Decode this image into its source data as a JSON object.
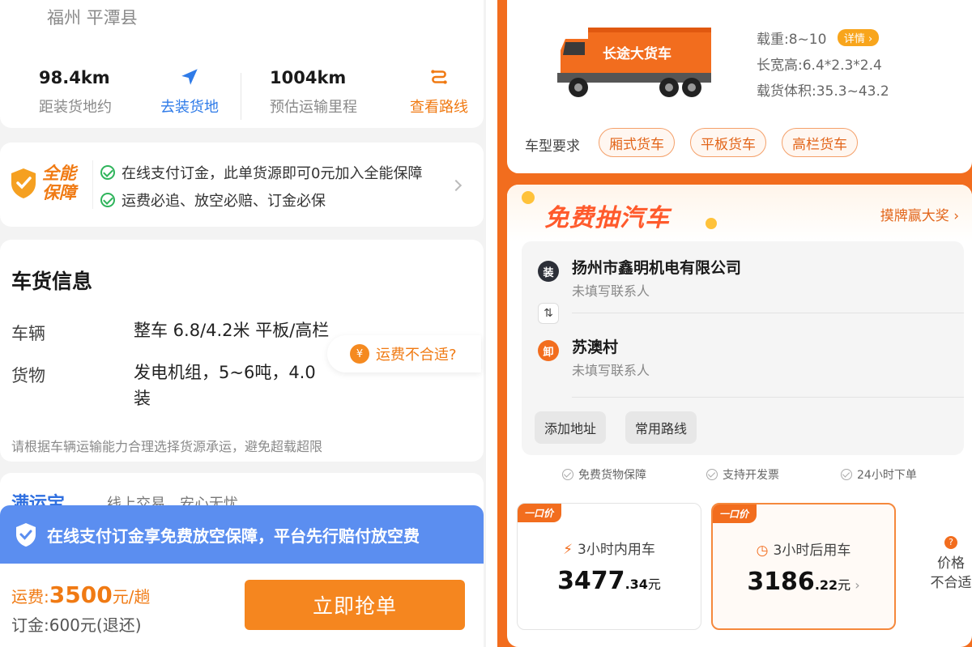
{
  "left": {
    "region": "福州 平潭县",
    "distance_to_load": {
      "value": "98.4km",
      "label": "距装货地约"
    },
    "go_load": "去装货地",
    "estimated_mileage": {
      "value": "1004km",
      "label": "预估运输里程"
    },
    "view_route": "查看路线",
    "guarantee": {
      "title_line1": "全能",
      "title_line2": "保障",
      "line1": "在线支付订金，此单货源即可0元加入全能保障",
      "line2": "运费必追、放空必赔、订金必保"
    },
    "info": {
      "title": "车货信息",
      "vehicle_label": "车辆",
      "vehicle_value": "整车 6.8/4.2米 平板/高栏",
      "cargo_label": "货物",
      "cargo_value_line1": "发电机组，5~6吨，4.0",
      "cargo_value_line2": "装",
      "tip": "请根据车辆运输能力合理选择货源承运，避免超载超限"
    },
    "fee_unfit": "运费不合适?",
    "brand": {
      "logo": "满运宝",
      "slogan": "线上交易，安心无忧"
    },
    "banner": "在线支付订金享免费放空保障，平台先行赔付放空费",
    "freight_label": "运费:",
    "freight_value": "3500",
    "freight_unit": "元/趟",
    "deposit": "订金:600元(退还)",
    "grab_button": "立即抢单"
  },
  "right": {
    "truck_text": "长途大货车",
    "load": "载重:8~10",
    "detail": "详情",
    "dims": "长宽高:6.4*2.3*2.4",
    "volume": "载货体积:35.3~43.2",
    "vehicle_req_label": "车型要求",
    "vehicle_types": [
      "厢式货车",
      "平板货车",
      "高栏货车"
    ],
    "lottery_title": "免费抽汽车",
    "lottery_link": "摸牌赢大奖",
    "load_icon": "装",
    "load_name": "扬州市鑫明机电有限公司",
    "load_contact": "未填写联系人",
    "unload_icon": "卸",
    "unload_name": "苏澳村",
    "unload_contact": "未填写联系人",
    "add_address": "添加地址",
    "common_routes": "常用路线",
    "perks": [
      "免费货物保障",
      "支持开发票",
      "24小时下单"
    ],
    "price_tag": "一口价",
    "option1": {
      "time": "3小时内用车",
      "price_int": "3477",
      "price_dec": ".34",
      "unit": "元"
    },
    "option2": {
      "time": "3小时后用车",
      "price_int": "3186",
      "price_dec": ".22",
      "unit": "元"
    },
    "unfit_line1": "价格",
    "unfit_line2": "不合适"
  },
  "colors": {
    "accent": "#f26d1e",
    "banner": "#5b8ef0",
    "check": "#2fb45b"
  }
}
